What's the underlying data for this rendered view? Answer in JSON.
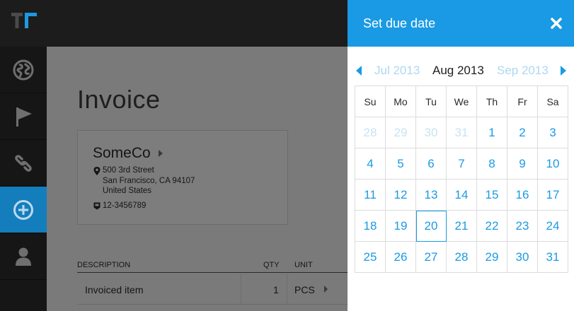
{
  "main": {
    "page_title": "Invoice",
    "company": {
      "name": "SomeCo",
      "address_line1": "500 3rd Street",
      "address_line2": "San Francisco, CA 94107",
      "address_line3": "United States",
      "phone": "12-3456789"
    },
    "table": {
      "headers": {
        "description": "DESCRIPTION",
        "qty": "QTY",
        "unit": "UNIT"
      },
      "rows": [
        {
          "description": "Invoiced item",
          "qty": "1",
          "unit": "PCS"
        }
      ]
    }
  },
  "sidenav": {
    "icons": [
      "globe-icon",
      "flag-icon",
      "link-icon",
      "plus-circle-icon",
      "user-icon"
    ],
    "active_index": 3
  },
  "due_date_panel": {
    "title": "Set due date",
    "close_label": "×",
    "prev_month": "Jul 2013",
    "current_month": "Aug 2013",
    "next_month": "Sep 2013",
    "weekdays": [
      "Su",
      "Mo",
      "Tu",
      "We",
      "Th",
      "Fr",
      "Sa"
    ],
    "weeks": [
      [
        "28",
        "29",
        "30",
        "31",
        "1",
        "2",
        "3"
      ],
      [
        "4",
        "5",
        "6",
        "7",
        "8",
        "9",
        "10"
      ],
      [
        "11",
        "12",
        "13",
        "14",
        "15",
        "16",
        "17"
      ],
      [
        "18",
        "19",
        "20",
        "21",
        "22",
        "23",
        "24"
      ],
      [
        "25",
        "26",
        "27",
        "28",
        "29",
        "30",
        "31"
      ]
    ],
    "other_month_cells": [
      [
        0,
        0
      ],
      [
        0,
        1
      ],
      [
        0,
        2
      ],
      [
        0,
        3
      ]
    ],
    "selected_day": "20"
  },
  "colors": {
    "accent": "#1a9ae4",
    "active_nav": "#147ebd",
    "topbar": "#1c1c1c",
    "overlay_bg": "#7a7a7a"
  }
}
